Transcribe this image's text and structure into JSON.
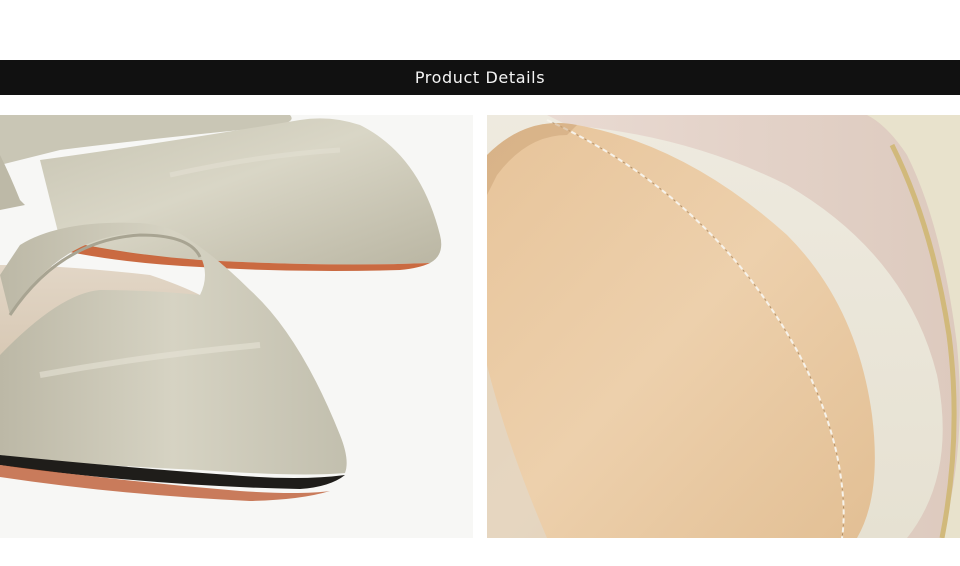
{
  "header": {
    "title": "Product Details"
  },
  "colors": {
    "banner_background": "#111111",
    "banner_text": "#f4f4f4",
    "page_background": "#ffffff"
  },
  "images": [
    {
      "name": "shoe-toe-closeup-photo"
    },
    {
      "name": "shoe-insole-closeup-photo"
    }
  ]
}
